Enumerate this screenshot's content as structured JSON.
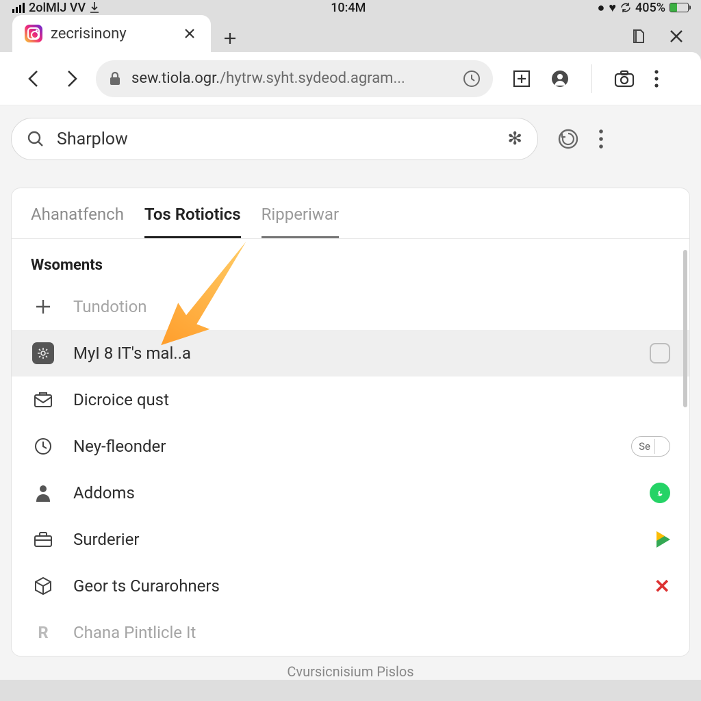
{
  "status_bar": {
    "carrier": "2olMlJ VV",
    "time": "10:4M",
    "battery_pct": "405%"
  },
  "browser": {
    "tab_title": "zecrisinony",
    "url_secure_prefix": "sew.tiola.ogr.",
    "url_rest": "/hytrw.syht.sydeod.agram..."
  },
  "page_search": {
    "value": "Sharplow"
  },
  "tabs": {
    "t0": "Ahanatfench",
    "t1": "Tos Rotiotics",
    "t2": "Ripperiwar"
  },
  "section": {
    "heading": "Wsoments"
  },
  "rows": {
    "r0": "Tundotion",
    "r1": "MyI 8 IT's mal..a",
    "r2": "Dicroice qust",
    "r3": "Ney-fleonder",
    "r3_pill": "Se",
    "r4": "Addoms",
    "r5": "Surderier",
    "r6": "Geor ts Curarohners",
    "r7": "Chana Pintlicle It"
  },
  "footer_hint": "Cvursicnisium Pislos"
}
